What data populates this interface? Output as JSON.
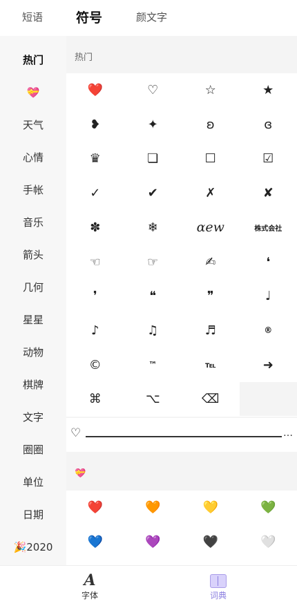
{
  "tabs": {
    "phrases": "短语",
    "symbols": "符号",
    "kaomoji": "颜文字"
  },
  "sidebar": {
    "items": [
      {
        "label": "热门"
      },
      {
        "label": "💝"
      },
      {
        "label": "天气"
      },
      {
        "label": "心情"
      },
      {
        "label": "手帐"
      },
      {
        "label": "音乐"
      },
      {
        "label": "箭头"
      },
      {
        "label": "几何"
      },
      {
        "label": "星星"
      },
      {
        "label": "动物"
      },
      {
        "label": "棋牌"
      },
      {
        "label": "文字"
      },
      {
        "label": "圈圈"
      },
      {
        "label": "单位"
      },
      {
        "label": "日期"
      },
      {
        "label": "🎉2020"
      }
    ]
  },
  "sections": {
    "hot": {
      "title": "热门",
      "symbols": [
        "❤️",
        "♡",
        "☆",
        "★",
        "❥",
        "✦",
        "ʚ",
        "ɞ",
        "♛",
        "❏",
        "☐",
        "☑",
        "✓",
        "✔",
        "✗",
        "✘",
        "✽",
        "❄",
        "ɑew",
        "株式会社",
        "☜",
        "☞",
        "✍",
        "❛",
        "❜",
        "❝",
        "❞",
        "♩",
        "♪",
        "♫",
        "♬",
        "®",
        "©",
        "™",
        "℡",
        "➜",
        "⌘",
        "⌥",
        "⌫"
      ],
      "divider": {
        "left": "♡",
        "right": "…"
      }
    },
    "hearts": {
      "title": "💝",
      "symbols": [
        "❤️",
        "🧡",
        "💛",
        "💚",
        "💙",
        "💜",
        "🖤",
        "🤍"
      ]
    }
  },
  "bottom": {
    "font": "字体",
    "dict": "词典",
    "font_icon": "A"
  }
}
